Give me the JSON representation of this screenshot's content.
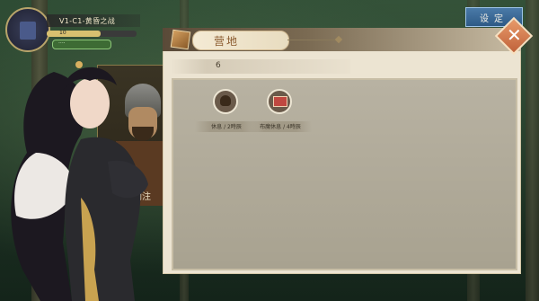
{
  "hud": {
    "title": "V1-C1-黄昏之战",
    "bar1_text": "10",
    "bar1_fill": 0.6,
    "bar2_text": "····"
  },
  "settings": {
    "label": "设定"
  },
  "panel": {
    "title": "营地",
    "count": "6",
    "close_label": "✕",
    "items": [
      {
        "label": "休息 / 2時辰",
        "icon": "rest-icon"
      },
      {
        "label": "布魔休息 / 4時辰",
        "icon": "book-icon"
      }
    ]
  },
  "portrait": {
    "name": "刘注"
  },
  "colors": {
    "accent": "#c0623a",
    "panel_bg": "#ece4d2",
    "inner_bg": "#b0aa98",
    "settings_blue": "#3a6a98"
  }
}
